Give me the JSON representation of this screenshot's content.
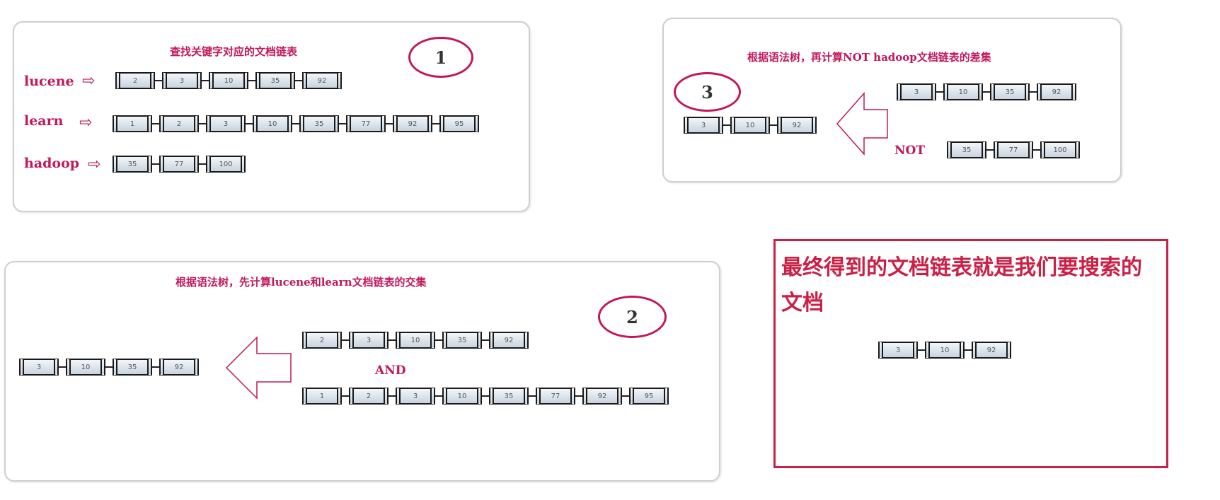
{
  "panel1": {
    "title": "查找关键字对应的文档链表",
    "step": "1",
    "rows": [
      {
        "term": "lucene",
        "docs": [
          "2",
          "3",
          "10",
          "35",
          "92"
        ]
      },
      {
        "term": "learn",
        "docs": [
          "1",
          "2",
          "3",
          "10",
          "35",
          "77",
          "92",
          "95"
        ]
      },
      {
        "term": "hadoop",
        "docs": [
          "35",
          "77",
          "100"
        ]
      }
    ]
  },
  "panel2": {
    "title": "根据语法树，先计算lucene和learn文档链表的交集",
    "step": "2",
    "op": "AND",
    "input_a": [
      "2",
      "3",
      "10",
      "35",
      "92"
    ],
    "input_b": [
      "1",
      "2",
      "3",
      "10",
      "35",
      "77",
      "92",
      "95"
    ],
    "result": [
      "3",
      "10",
      "35",
      "92"
    ]
  },
  "panel3": {
    "title": "根据语法树，再计算NOT hadoop文档链表的差集",
    "step": "3",
    "op": "NOT",
    "input_a": [
      "3",
      "10",
      "35",
      "92"
    ],
    "input_b": [
      "35",
      "77",
      "100"
    ],
    "result": [
      "3",
      "10",
      "92"
    ]
  },
  "final": {
    "text": "最终得到的文档链表就是我们要搜索的文档",
    "docs": [
      "3",
      "10",
      "92"
    ]
  },
  "colors": {
    "accent": "#c2185b",
    "result_border": "#cc1f45",
    "node_border": "#1a1a1a"
  }
}
